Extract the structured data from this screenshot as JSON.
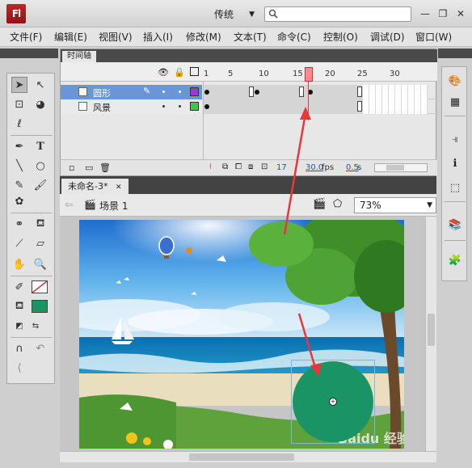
{
  "app": {
    "logo": "Fl",
    "workspace": "传统"
  },
  "window_controls": {
    "minimize": "—",
    "restore": "❐",
    "close": "✕"
  },
  "menu": [
    "文件(F)",
    "编辑(E)",
    "视图(V)",
    "插入(I)",
    "修改(M)",
    "文本(T)",
    "命令(C)",
    "控制(O)",
    "调试(D)",
    "窗口(W)"
  ],
  "timeline": {
    "tab_label": "时间轴",
    "ruler": [
      "1",
      "5",
      "10",
      "15",
      "20",
      "25",
      "30"
    ],
    "layers": [
      {
        "name": "圆形",
        "color": "#9b3bc8",
        "selected": true
      },
      {
        "name": "风景",
        "color": "#3cc84a",
        "selected": false
      }
    ],
    "current_frame": "17",
    "fps": "30.0",
    "fps_unit": "fps",
    "time": "0.5",
    "time_unit": "s"
  },
  "document": {
    "tab_label": "未命名-3*",
    "scene_label": "场景 1",
    "zoom": "73%",
    "circle_color": "#1a9464"
  },
  "colors": {
    "stroke_swatch": "#ffffff",
    "fill_swatch": "#1a9464",
    "annotation": "#e8373a"
  },
  "tool_icons": [
    "selection-icon",
    "subselection-icon",
    "free-transform-icon",
    "3d-rotation-icon",
    "lasso-icon",
    "pen-icon",
    "text-icon",
    "line-icon",
    "oval-icon",
    "pencil-icon",
    "brush-icon",
    "deco-icon",
    "bone-icon",
    "paint-bucket-icon",
    "eyedropper-icon",
    "eraser-icon",
    "hand-icon",
    "zoom-icon"
  ],
  "watermark": "Baidu 经验"
}
